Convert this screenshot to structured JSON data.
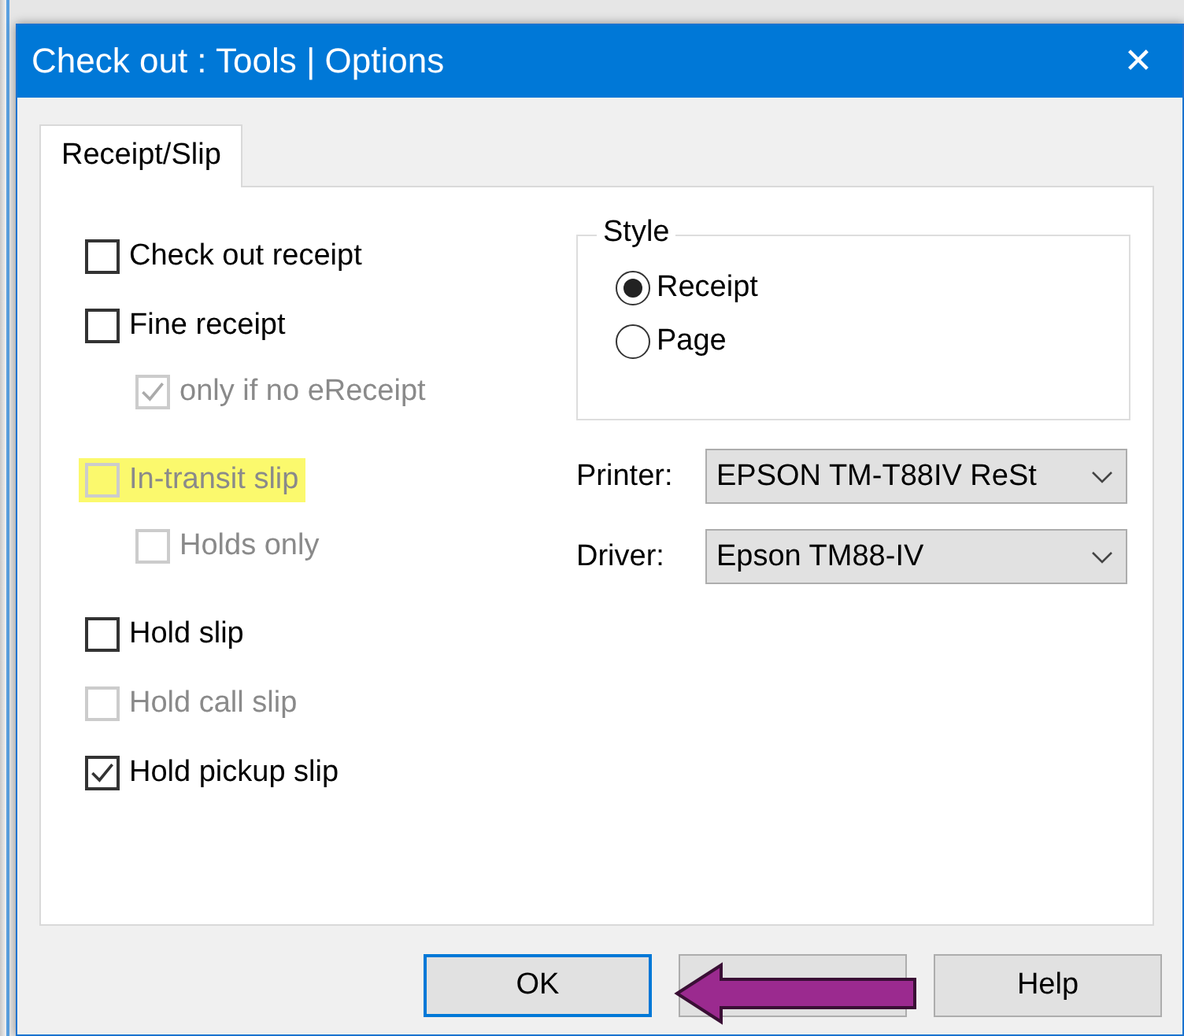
{
  "window": {
    "title": "Check out : Tools | Options",
    "close_glyph": "✕"
  },
  "tabs": [
    {
      "label": "Receipt/Slip",
      "selected": true
    }
  ],
  "slip_groups": [
    {
      "items": [
        {
          "label": "Check out receipt",
          "checked": false,
          "disabled": false,
          "highlighted": false
        },
        {
          "label": "Fine receipt",
          "checked": false,
          "disabled": false,
          "highlighted": false,
          "children": [
            {
              "label": "only if no eReceipt",
              "checked": true,
              "disabled": true,
              "highlighted": false
            }
          ]
        }
      ]
    },
    {
      "items": [
        {
          "label": "In-transit slip",
          "checked": false,
          "disabled": true,
          "highlighted": true,
          "children": [
            {
              "label": "Holds only",
              "checked": false,
              "disabled": true,
              "highlighted": false
            }
          ]
        }
      ]
    },
    {
      "items": [
        {
          "label": "Hold slip",
          "checked": false,
          "disabled": false,
          "highlighted": false
        },
        {
          "label": "Hold call slip",
          "checked": false,
          "disabled": true,
          "highlighted": false
        },
        {
          "label": "Hold pickup slip",
          "checked": true,
          "disabled": false,
          "highlighted": false
        }
      ]
    }
  ],
  "style": {
    "title": "Style",
    "options": [
      {
        "label": "Receipt",
        "selected": true
      },
      {
        "label": "Page",
        "selected": false
      }
    ]
  },
  "printer": {
    "label": "Printer:",
    "value": "EPSON TM-T88IV ReSt"
  },
  "driver": {
    "label": "Driver:",
    "value": "Epson TM88-IV"
  },
  "buttons": [
    {
      "kind": "ok",
      "label": "OK",
      "focused": true
    },
    {
      "kind": "cancel",
      "focused": false
    },
    {
      "kind": "help",
      "label": "Help",
      "focused": false
    }
  ]
}
